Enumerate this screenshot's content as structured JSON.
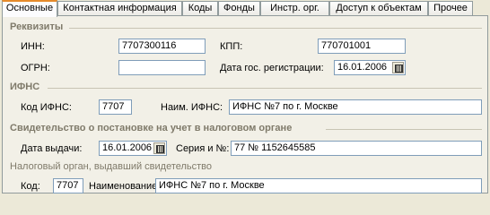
{
  "tabs": [
    {
      "label": "Основные"
    },
    {
      "label": "Контактная информация"
    },
    {
      "label": "Коды"
    },
    {
      "label": "Фонды"
    },
    {
      "label": "Инстр. орг."
    },
    {
      "label": "Доступ к объектам"
    },
    {
      "label": "Прочее"
    }
  ],
  "requisites": {
    "title": "Реквизиты",
    "inn_label": "ИНН:",
    "inn_value": "7707300116",
    "kpp_label": "КПП:",
    "kpp_value": "770701001",
    "ogrn_label": "ОГРН:",
    "ogrn_value": "",
    "reg_date_label": "Дата гос. регистрации:",
    "reg_date_value": "16.01.2006"
  },
  "ifns": {
    "title": "ИФНС",
    "code_label": "Код ИФНС:",
    "code_value": "7707",
    "name_label": "Наим. ИФНС:",
    "name_value": "ИФНС №7 по г. Москве"
  },
  "certificate": {
    "title": "Свидетельство о постановке на учет в налоговом органе",
    "issue_date_label": "Дата выдачи:",
    "issue_date_value": "16.01.2006",
    "series_label": "Серия и №:",
    "series_value": "77 № 1152645585",
    "issuer_caption": "Налоговый орган, выдавший свидетельство",
    "code_label": "Код:",
    "code_value": "7707",
    "name_label": "Наименование:",
    "name_value": "ИФНС №7 по г. Москве"
  }
}
